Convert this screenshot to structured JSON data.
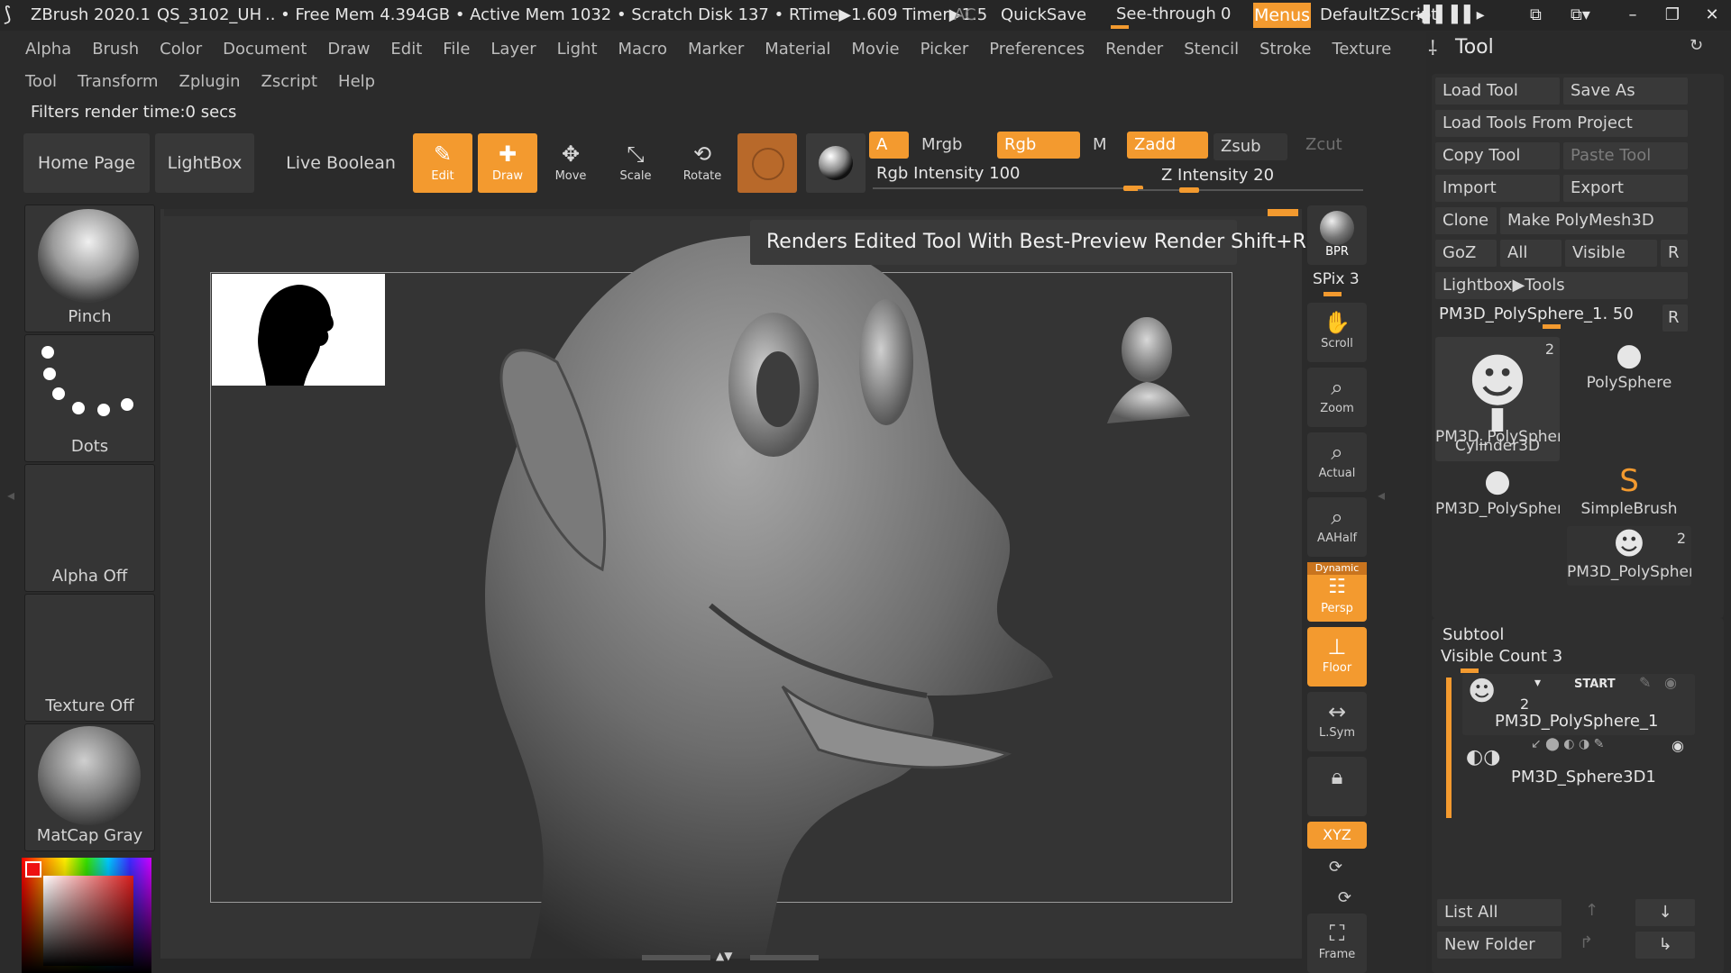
{
  "titlebar": {
    "app": "ZBrush 2020.1",
    "doc": "QS_3102_UH",
    "stats": ".. • Free Mem 4.394GB • Active Mem 1032 • Scratch Disk 137 • RTime▶1.609 Timer▶1.5",
    "ac": "AC",
    "quicksave": "QuickSave",
    "seethrough_label": "See-through",
    "seethrough_value": "0",
    "menus": "Menus",
    "script": "DefaultZScript"
  },
  "menu_row1": [
    "Alpha",
    "Brush",
    "Color",
    "Document",
    "Draw",
    "Edit",
    "File",
    "Layer",
    "Light",
    "Macro",
    "Marker",
    "Material",
    "Movie",
    "Picker",
    "Preferences",
    "Render",
    "Stencil",
    "Stroke",
    "Texture"
  ],
  "menu_row2": [
    "Tool",
    "Transform",
    "Zplugin",
    "Zscript",
    "Help"
  ],
  "status": "Filters render time:0 secs",
  "shelf": {
    "home": "Home Page",
    "lightbox": "LightBox",
    "liveboolean": "Live Boolean",
    "edit": "Edit",
    "draw": "Draw",
    "move": "Move",
    "scale": "Scale",
    "rotate": "Rotate",
    "a": "A",
    "mrgb": "Mrgb",
    "rgb": "Rgb",
    "m": "M",
    "zadd": "Zadd",
    "zsub": "Zsub",
    "zcut": "Zcut",
    "rgb_intensity": "Rgb Intensity 100",
    "z_intensity": "Z Intensity 20",
    "rgb_intensity_level": 1.0,
    "z_intensity_level": 0.2
  },
  "left_palette": {
    "brush": "Pinch",
    "stroke": "Dots",
    "alpha": "Alpha Off",
    "texture": "Texture Off",
    "material": "MatCap Gray"
  },
  "tooltip": "Renders Edited Tool With Best-Preview Render  Shift+R",
  "right_toolbar": {
    "bpr": "BPR",
    "spix": "SPix 3",
    "scroll": "Scroll",
    "zoom": "Zoom",
    "actual": "Actual",
    "aahalf": "AAHalf",
    "dynamic": "Dynamic",
    "persp": "Persp",
    "floor": "Floor",
    "lsym": "L.Sym",
    "xyz": "XYZ",
    "frame": "Frame"
  },
  "tool_panel": {
    "title": "Tool",
    "load_tool": "Load Tool",
    "save_as": "Save As",
    "load_from_project": "Load Tools From Project",
    "copy_tool": "Copy Tool",
    "paste_tool": "Paste Tool",
    "import": "Import",
    "export": "Export",
    "clone": "Clone",
    "make_polymesh": "Make PolyMesh3D",
    "goz": "GoZ",
    "all": "All",
    "visible": "Visible",
    "r": "R",
    "lightbox_tools": "Lightbox▶Tools",
    "current_tool": "PM3D_PolySphere_1. 50",
    "current_tool_level": 0.5,
    "thumbs": [
      {
        "name": "PM3D_PolySpher",
        "count": "2"
      },
      {
        "name": "PolySphere",
        "count": ""
      },
      {
        "name": "Cylinder3D",
        "count": ""
      },
      {
        "name": "SimpleBrush",
        "count": ""
      },
      {
        "name": "PM3D_PolySpher",
        "count": ""
      },
      {
        "name": "PM3D_PolySpher",
        "count": "2"
      }
    ]
  },
  "subtool": {
    "title": "Subtool",
    "visible_count": "Visible Count 3",
    "start": "START",
    "item1_count": "2",
    "item1_name": "PM3D_PolySphere_1",
    "item2_name": "PM3D_Sphere3D1",
    "list_all": "List All",
    "new_folder": "New Folder"
  },
  "colors": {
    "accent": "#f39a2f",
    "panel": "#2a2a2a",
    "canvas": "#333333"
  }
}
